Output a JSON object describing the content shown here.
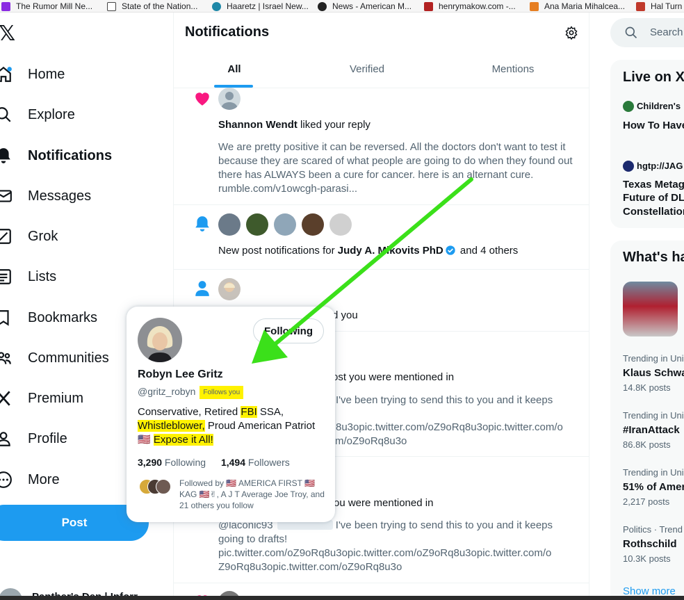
{
  "bookmarks": [
    {
      "label": "The Rumor Mill Ne...",
      "color": "#8a2be2"
    },
    {
      "label": "State of the Nation...",
      "color": "#ffffff"
    },
    {
      "label": "Haaretz | Israel New...",
      "color": "#1e88a8"
    },
    {
      "label": "News - American M...",
      "color": "#222222"
    },
    {
      "label": "henrymakow.com -...",
      "color": "#b22222"
    },
    {
      "label": "Ana Maria Mihalcea...",
      "color": "#e67e22"
    },
    {
      "label": "Hal Turn",
      "color": "#c0392b"
    }
  ],
  "nav": {
    "logo": "𝕏",
    "items": [
      {
        "label": "Home",
        "icon": "home-icon"
      },
      {
        "label": "Explore",
        "icon": "search-icon"
      },
      {
        "label": "Notifications",
        "icon": "bell-icon"
      },
      {
        "label": "Messages",
        "icon": "envelope-icon"
      },
      {
        "label": "Grok",
        "icon": "grok-icon"
      },
      {
        "label": "Lists",
        "icon": "list-icon"
      },
      {
        "label": "Bookmarks",
        "icon": "bookmark-icon"
      },
      {
        "label": "Communities",
        "icon": "people-icon"
      },
      {
        "label": "Premium",
        "icon": "x-icon"
      },
      {
        "label": "Profile",
        "icon": "person-icon"
      },
      {
        "label": "More",
        "icon": "more-icon"
      }
    ],
    "post_label": "Post",
    "account_name": "Panther's Den | Inforr"
  },
  "header": {
    "title": "Notifications",
    "tabs": [
      "All",
      "Verified",
      "Mentions"
    ]
  },
  "notifications": {
    "n1": {
      "actor": "Shannon Wendt",
      "action": " liked your reply",
      "text": "We are pretty positive it can be reversed. All the doctors don't want to test it because they are scared of what people are going to do when they found out there has ALWAYS been a cure for cancer. here is an alternant cure. rumble.com/v1owcgh-parasi..."
    },
    "n2": {
      "prefix": "New post notifications for ",
      "actor": "Judy A. Mikovits PhD",
      "suffix": " and 4 others"
    },
    "n3": {
      "tail": "d you"
    },
    "n4": {
      "line1": "ost you were mentioned in",
      "line2": "I've been trying to send this to you and it keeps",
      "line3": "8u3opic.twitter.com/oZ9oRq8u3opic.twitter.com/o",
      "line4": "m/oZ9oRq8u3o"
    },
    "n5": {
      "line1": "ou were mentioned in",
      "handle": "@laconic93",
      "line2": " I've been trying to send this to you and it keeps",
      "line3": "going to drafts!",
      "line4": "pic.twitter.com/oZ9oRq8u3opic.twitter.com/oZ9oRq8u3opic.twitter.com/o",
      "line5": "Z9oRq8u3opic.twitter.com/oZ9oRq8u3o"
    }
  },
  "hover_card": {
    "name": "Robyn Lee Gritz",
    "handle": "@gritz_robyn",
    "follows_you": "Follows you",
    "follow_button": "Following",
    "bio_1": "Conservative, Retired ",
    "bio_fbi": "FBI",
    "bio_2": " SSA,",
    "bio_whistle": "Whistleblower,",
    "bio_3": " Proud American Patriot",
    "bio_flag": "🇺🇸",
    "bio_expose": "Expose it All!",
    "following_count": "3,290",
    "following_label": " Following",
    "followers_count": "1,494",
    "followers_label": " Followers",
    "followed_by": "Followed by 🇺🇸 AMERICA FIRST 🇺🇸 KAG 🇺🇸✌, A J T Average Joe Troy, and 21 others you follow"
  },
  "right": {
    "search_placeholder": "Search",
    "live_title": "Live on X",
    "live_items": [
      {
        "host": "Children's",
        "title": "How To Have"
      },
      {
        "host": "hgtp://JAG",
        "title_1": "Texas Metag",
        "title_2": "Future of DLT",
        "title_3": "Constellation"
      }
    ],
    "whats_title": "What's ha",
    "trends": [
      {
        "meta": "Trending in Uni",
        "name": "Klaus Schwa",
        "count": "14.8K posts"
      },
      {
        "meta": "Trending in Uni",
        "name": "#IranAttack",
        "count": "86.8K posts"
      },
      {
        "meta": "Trending in Uni",
        "name": "51% of Amer",
        "count": "2,217 posts"
      },
      {
        "meta": "Politics · Trend",
        "name": "Rothschild",
        "count": "10.3K posts"
      }
    ],
    "show_more": "Show more"
  },
  "colors": {
    "accent": "#1d9bf0",
    "like": "#f91880",
    "arrow": "#3be01a",
    "highlight": "#fff200"
  }
}
